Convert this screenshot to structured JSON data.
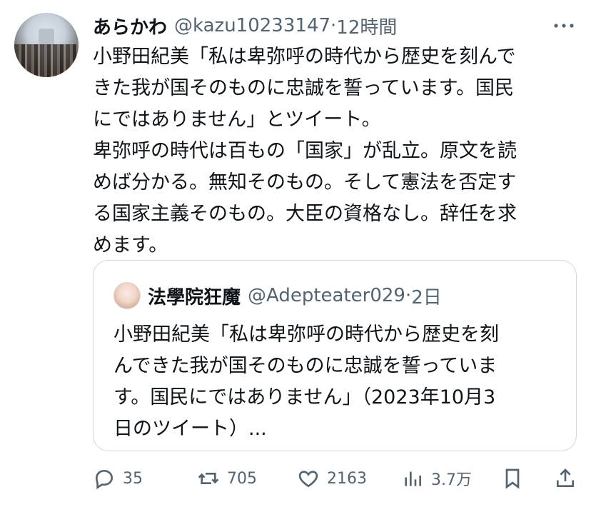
{
  "author": {
    "name": "あらかわ",
    "handle": "@kazu10233147",
    "separator": "·",
    "time": "12時間"
  },
  "tweet": {
    "text": "小野田紀美「私は卑弥呼の時代から歴史を刻んで\nきた我が国そのものに忠誠を誓っています。国民\nにではありません」とツイート。\n卑弥呼の時代は百もの「国家」が乱立。原文を読\nめば分かる。無知そのもの。そして憲法を否定す\nる国家主義そのもの。大臣の資格なし。辞任を求\nめます。"
  },
  "quote": {
    "name": "法學院狂魔",
    "handle": "@Adepteater029",
    "separator": "·",
    "time": "2日",
    "text": "小野田紀美「私は卑弥呼の時代から歴史を刻\nんできた我が国そのものに忠誠を誓っていま\nす。国民にではありません」（2023年10月3\n日のツイート）..."
  },
  "actions": {
    "reply_count": "35",
    "retweet_count": "705",
    "like_count": "2163",
    "views_count": "3.7万"
  },
  "icons": {
    "more": "more-icon",
    "reply": "reply-icon",
    "retweet": "retweet-icon",
    "like": "heart-icon",
    "views": "views-icon",
    "bookmark": "bookmark-icon",
    "share": "share-icon"
  },
  "colors": {
    "text": "#0f1419",
    "secondary": "#536471",
    "border": "#cfd9de"
  }
}
